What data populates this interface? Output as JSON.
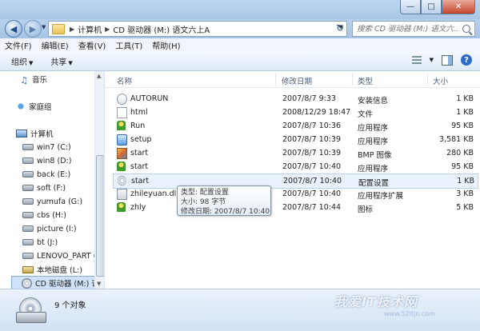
{
  "address": {
    "crumbs": [
      "计算机",
      "CD 驱动器 (M:) 语文六上A"
    ],
    "search_placeholder": "搜索 CD 驱动器 (M:) 语文六..."
  },
  "menu": [
    "文件(F)",
    "编辑(E)",
    "查看(V)",
    "工具(T)",
    "帮助(H)"
  ],
  "toolbar": {
    "organize": "组织",
    "share": "共享"
  },
  "nav": {
    "items": [
      {
        "label": "音乐",
        "icon": "music-icon"
      },
      {
        "label": "家庭组",
        "icon": "homegroup-icon"
      },
      {
        "label": "计算机",
        "icon": "computer-icon"
      },
      {
        "label": "win7 (C:)",
        "icon": "drive-icon"
      },
      {
        "label": "win8 (D:)",
        "icon": "drive-icon"
      },
      {
        "label": "back (E:)",
        "icon": "drive-icon"
      },
      {
        "label": "soft (F:)",
        "icon": "drive-icon"
      },
      {
        "label": "yumufa (G:)",
        "icon": "drive-icon"
      },
      {
        "label": "cbs (H:)",
        "icon": "drive-icon"
      },
      {
        "label": "picture (I:)",
        "icon": "drive-icon"
      },
      {
        "label": "bt (J:)",
        "icon": "drive-icon"
      },
      {
        "label": "LENOVO_PART (",
        "icon": "drive-icon"
      },
      {
        "label": "本地磁盘 (L:)",
        "icon": "local-disk-icon"
      },
      {
        "label": "CD 驱动器 (M:) 语",
        "icon": "cd-drive-icon"
      }
    ]
  },
  "columns": {
    "name": "名称",
    "date": "修改日期",
    "type": "类型",
    "size": "大小"
  },
  "files": [
    {
      "name": "AUTORUN",
      "date": "2007/8/7 9:33",
      "type": "安装信息",
      "size": "1 KB",
      "icon": "setup-info-icon"
    },
    {
      "name": "html",
      "date": "2008/12/29 18:47",
      "type": "文件",
      "size": "1 KB",
      "icon": "file-icon"
    },
    {
      "name": "Run",
      "date": "2007/8/7 10:36",
      "type": "应用程序",
      "size": "95 KB",
      "icon": "app-icon"
    },
    {
      "name": "setup",
      "date": "2007/8/7 10:39",
      "type": "应用程序",
      "size": "3,581 KB",
      "icon": "setup-icon"
    },
    {
      "name": "start",
      "date": "2007/8/7 10:39",
      "type": "BMP 图像",
      "size": "280 KB",
      "icon": "bmp-icon"
    },
    {
      "name": "start",
      "date": "2007/8/7 10:40",
      "type": "应用程序",
      "size": "95 KB",
      "icon": "app-icon"
    },
    {
      "name": "start",
      "date": "2007/8/7 10:40",
      "type": "配置设置",
      "size": "1 KB",
      "icon": "config-icon"
    },
    {
      "name": "zhileyuan.dll",
      "date": "2007/8/7 10:40",
      "type": "应用程序扩展",
      "size": "3 KB",
      "icon": "dll-icon"
    },
    {
      "name": "zhly",
      "date": "2007/8/7 10:44",
      "type": "图标",
      "size": "5 KB",
      "icon": "icon-file-icon"
    }
  ],
  "tooltip": {
    "type": "类型: 配置设置",
    "size": "大小: 98 字节",
    "date": "修改日期: 2007/8/7 10:40"
  },
  "status": {
    "count": "9 个对象"
  },
  "watermark": "我爱IT技术网",
  "watermark_sub": "www.52itjn.com"
}
